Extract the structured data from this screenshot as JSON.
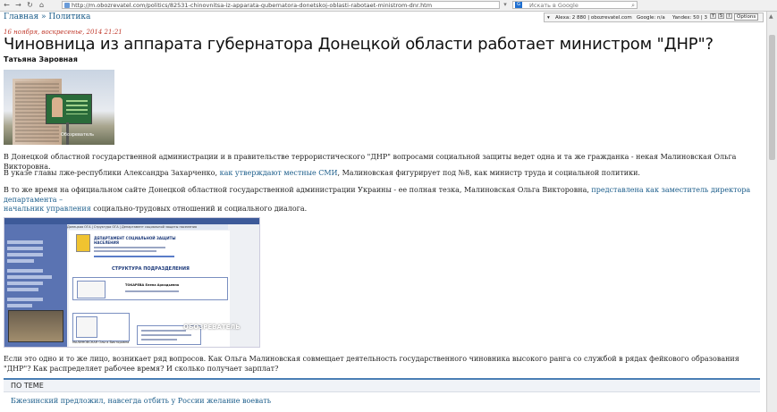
{
  "browser": {
    "url": "http://m.obozrevatel.com/politics/82531-chinovnitsa-iz-apparata-gubernatora-donetskoj-oblasti-rabotaet-ministrom-dnr.htm",
    "search_placeholder": "Искать в Google",
    "search_engine_label": "G",
    "back_glyph": "←",
    "forward_glyph": "→",
    "reload_glyph": "↻",
    "home_glyph": "⌂"
  },
  "seo_bar": {
    "alexa": "Alexa: 2 880 | obozrevatel.com",
    "google": "Google: n/a",
    "yandex": "Yandex: 50 | 3",
    "options_label": "Options",
    "icon_y": "Y",
    "icon_s": "S",
    "icon_i": "i",
    "icon_w": "W"
  },
  "breadcrumb": {
    "home": "Главная",
    "sep": " » ",
    "section": "Политика"
  },
  "article": {
    "date": "16 ноября, воскресенье, 2014 21:21",
    "title": "Чиновница из аппарата губернатора Донецкой области работает министром \"ДНР\"?",
    "author": "Татьяна Заровная",
    "photo_watermark": "Обозреватель",
    "p1": "В Донецкой областной государственной администрации и в правительстве террористического \"ДНР\" вопросами социальной защиты ведет одна и та же гражданка - некая Малиновская Ольга Викторовна.",
    "p2_pre": "В указе главы лже-республики Александра Захарченко, ",
    "p2_link": "как утверждают местные СМИ",
    "p2_post": ", Малиновская фигурирует под №8, как министр труда и социальной политики.",
    "p3_pre": "В то же время на официальном сайте Донецкой областной государственной администрации Украины - ее полная тезка, Малиновская Ольга Викторовна, ",
    "p3_link1": "представлена как заместитель директора департамента –",
    "p3_link2": "начальник управления",
    "p3_post": " социально-трудовых отношений и социального диалога.",
    "p4": "Если это одно и то же лицо, возникает ряд вопросов. Как Ольга Малиновская совмещает деятельность государственного чиновника высокого ранга со службой в рядах фейкового образования \"ДНР\"? Как распределяет рабочее время? И сколько получает зарплат?"
  },
  "screenshot": {
    "dept_title": "ДЕПАРТАМЕНТ СОЦИАЛЬНОЙ ЗАЩИТЫ НАСЕЛЕНИЯ",
    "structure_title": "СТРУКТУРА ПОДРАЗДЕЛЕНИЯ",
    "director_name": "ТОКАРЕВА Елена Аркадьевна",
    "malinovska": "МАЛИНОВСКАЯ Ольга Викторовна",
    "watermark": "ОБОЗРЕВАТЕЛЬ",
    "nav_strip": "Донецкая ОГА  |  Структура ОГА  |  Департамент социальной защиты населения"
  },
  "related": {
    "heading": "ПО ТЕМЕ",
    "link": "Бжезинский предложил, навсегда отбить у России желание воевать"
  }
}
